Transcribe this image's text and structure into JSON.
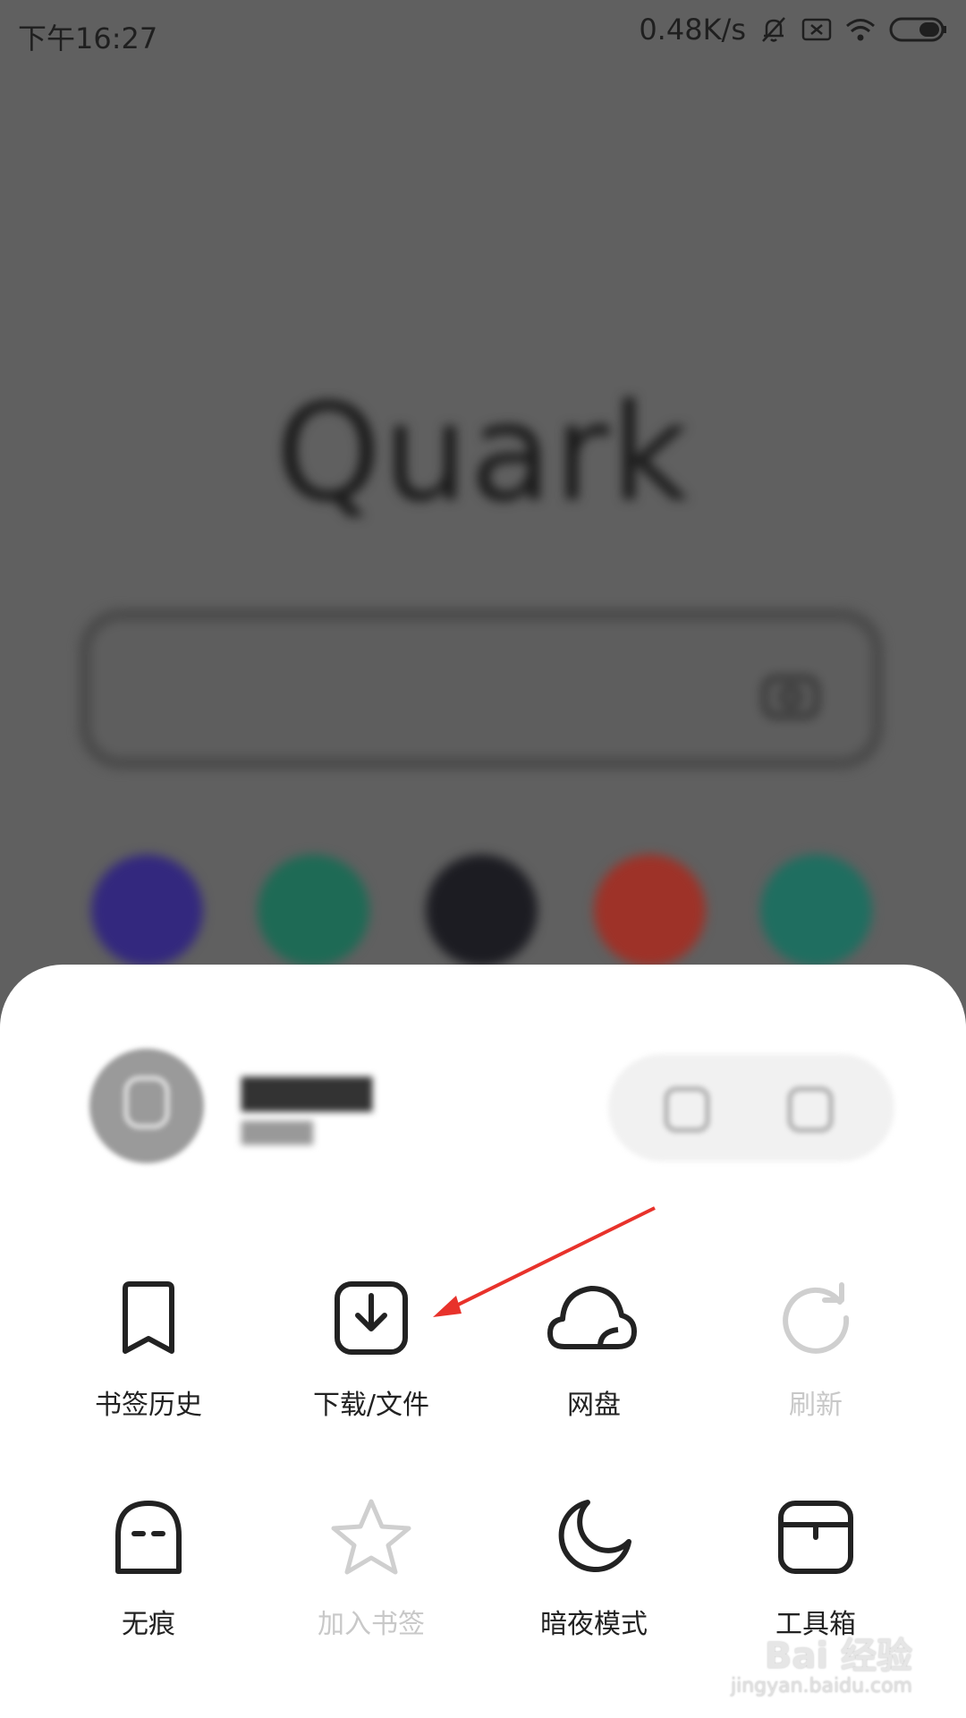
{
  "status_bar": {
    "time": "下午16:27",
    "speed": "0.48K/s",
    "icons": [
      "bell-muted-icon",
      "sim-x-icon",
      "wifi-icon",
      "battery-icon"
    ]
  },
  "home": {
    "logo": "Quark",
    "search_icon": "camera-icon",
    "quick_links_colors": [
      "#3a2d8c",
      "#1e6b55",
      "#1c1c1c",
      "#a23226",
      "#1f6e60"
    ]
  },
  "sheet": {
    "profile_icons": [
      "edit-icon",
      "camera-icon"
    ],
    "items": [
      {
        "label": "书签历史",
        "icon": "bookmark-icon",
        "enabled": true
      },
      {
        "label": "下载/文件",
        "icon": "download-icon",
        "enabled": true
      },
      {
        "label": "网盘",
        "icon": "cloud-icon",
        "enabled": true
      },
      {
        "label": "刷新",
        "icon": "refresh-icon",
        "enabled": false
      },
      {
        "label": "无痕",
        "icon": "ghost-icon",
        "enabled": true
      },
      {
        "label": "加入书签",
        "icon": "star-icon",
        "enabled": false
      },
      {
        "label": "暗夜模式",
        "icon": "moon-icon",
        "enabled": true
      },
      {
        "label": "工具箱",
        "icon": "toolbox-icon",
        "enabled": true
      }
    ]
  },
  "colors": {
    "annotation_arrow": "#e8322b",
    "sheet_bg": "#ffffff",
    "overlay_bg": "#606060"
  },
  "watermark": {
    "main": "Bai 经验",
    "sub": "jingyan.baidu.com"
  }
}
